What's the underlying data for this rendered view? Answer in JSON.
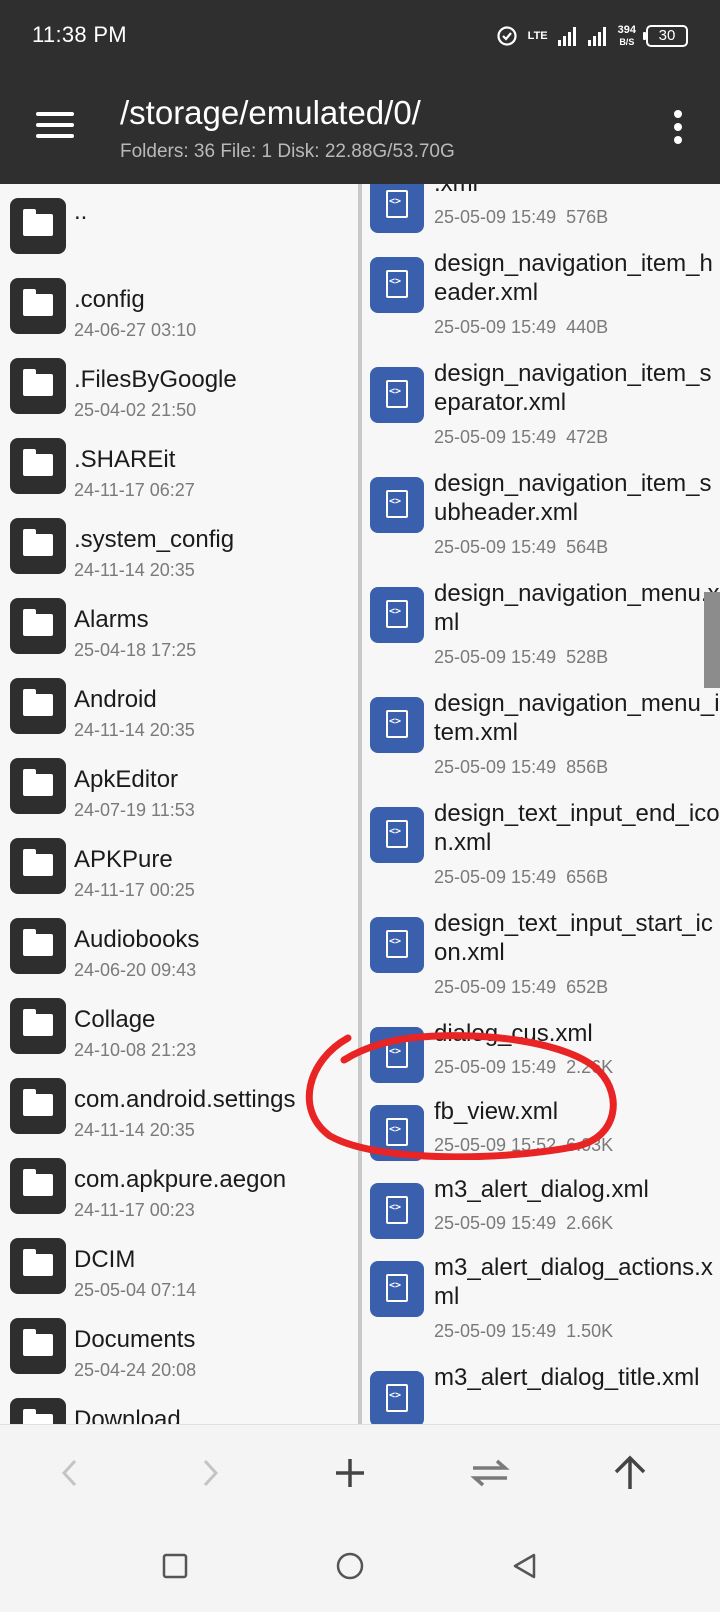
{
  "status_bar": {
    "time": "11:38 PM",
    "network_label": "LTE",
    "speed_value": "394",
    "speed_unit": "B/S",
    "battery": "30"
  },
  "app_bar": {
    "path": "/storage/emulated/0/",
    "info": "Folders: 36  File: 1  Disk: 22.88G/53.70G",
    "menu_icon": "hamburger-menu-icon",
    "more_icon": "more-vert-icon"
  },
  "left_pane": {
    "folders": [
      {
        "name": "..",
        "date": ""
      },
      {
        "name": ".config",
        "date": "24-06-27 03:10"
      },
      {
        "name": ".FilesByGoogle",
        "date": "25-04-02 21:50"
      },
      {
        "name": ".SHAREit",
        "date": "24-11-17 06:27"
      },
      {
        "name": ".system_config",
        "date": "24-11-14 20:35"
      },
      {
        "name": "Alarms",
        "date": "25-04-18 17:25"
      },
      {
        "name": "Android",
        "date": "24-11-14 20:35"
      },
      {
        "name": "ApkEditor",
        "date": "24-07-19 11:53"
      },
      {
        "name": "APKPure",
        "date": "24-11-17 00:25"
      },
      {
        "name": "Audiobooks",
        "date": "24-06-20 09:43"
      },
      {
        "name": "Collage",
        "date": "24-10-08 21:23"
      },
      {
        "name": "com.android.settings",
        "date": "24-11-14 20:35"
      },
      {
        "name": "com.apkpure.aegon",
        "date": "24-11-17 00:23"
      },
      {
        "name": "DCIM",
        "date": "25-05-04 07:14"
      },
      {
        "name": "Documents",
        "date": "25-04-24 20:08"
      },
      {
        "name": "Download",
        "date": ""
      }
    ]
  },
  "right_pane": {
    "files": [
      {
        "name": ".xml",
        "date": "25-05-09 15:49",
        "size": "576B",
        "rows": "top-cut"
      },
      {
        "name": "design_navigation_item_header.xml",
        "date": "25-05-09 15:49",
        "size": "440B",
        "rows": "double"
      },
      {
        "name": "design_navigation_item_separator.xml",
        "date": "25-05-09 15:49",
        "size": "472B",
        "rows": "double"
      },
      {
        "name": "design_navigation_item_subheader.xml",
        "date": "25-05-09 15:49",
        "size": "564B",
        "rows": "double"
      },
      {
        "name": "design_navigation_menu.xml",
        "date": "25-05-09 15:49",
        "size": "528B",
        "rows": "double"
      },
      {
        "name": "design_navigation_menu_item.xml",
        "date": "25-05-09 15:49",
        "size": "856B",
        "rows": "double"
      },
      {
        "name": "design_text_input_end_icon.xml",
        "date": "25-05-09 15:49",
        "size": "656B",
        "rows": "double"
      },
      {
        "name": "design_text_input_start_icon.xml",
        "date": "25-05-09 15:49",
        "size": "652B",
        "rows": "double"
      },
      {
        "name": "dialog_cus.xml",
        "date": "25-05-09 15:49",
        "size": "2.26K",
        "rows": "single"
      },
      {
        "name": "fb_view.xml",
        "date": "25-05-09 15:52",
        "size": "6.03K",
        "rows": "single"
      },
      {
        "name": "m3_alert_dialog.xml",
        "date": "25-05-09 15:49",
        "size": "2.66K",
        "rows": "single"
      },
      {
        "name": "m3_alert_dialog_actions.xml",
        "date": "25-05-09 15:49",
        "size": "1.50K",
        "rows": "double"
      },
      {
        "name": "m3_alert_dialog_title.xml",
        "date": "",
        "size": "",
        "rows": "double"
      }
    ]
  },
  "annotation": {
    "color": "#e82424",
    "shape": "hand-drawn circle around fb_view.xml"
  },
  "toolbar": {
    "back_icon": "chevron-left-icon",
    "forward_icon": "chevron-right-icon",
    "add_icon": "plus-icon",
    "swap_icon": "swap-arrows-icon",
    "up_icon": "arrow-up-icon"
  },
  "system_nav": {
    "recents_icon": "square-icon",
    "home_icon": "circle-icon",
    "back_icon": "triangle-back-icon"
  },
  "colors": {
    "app_bar": "#2f2f2f",
    "file_icon": "#3a60ad",
    "folder_icon": "#2e2e2e"
  }
}
